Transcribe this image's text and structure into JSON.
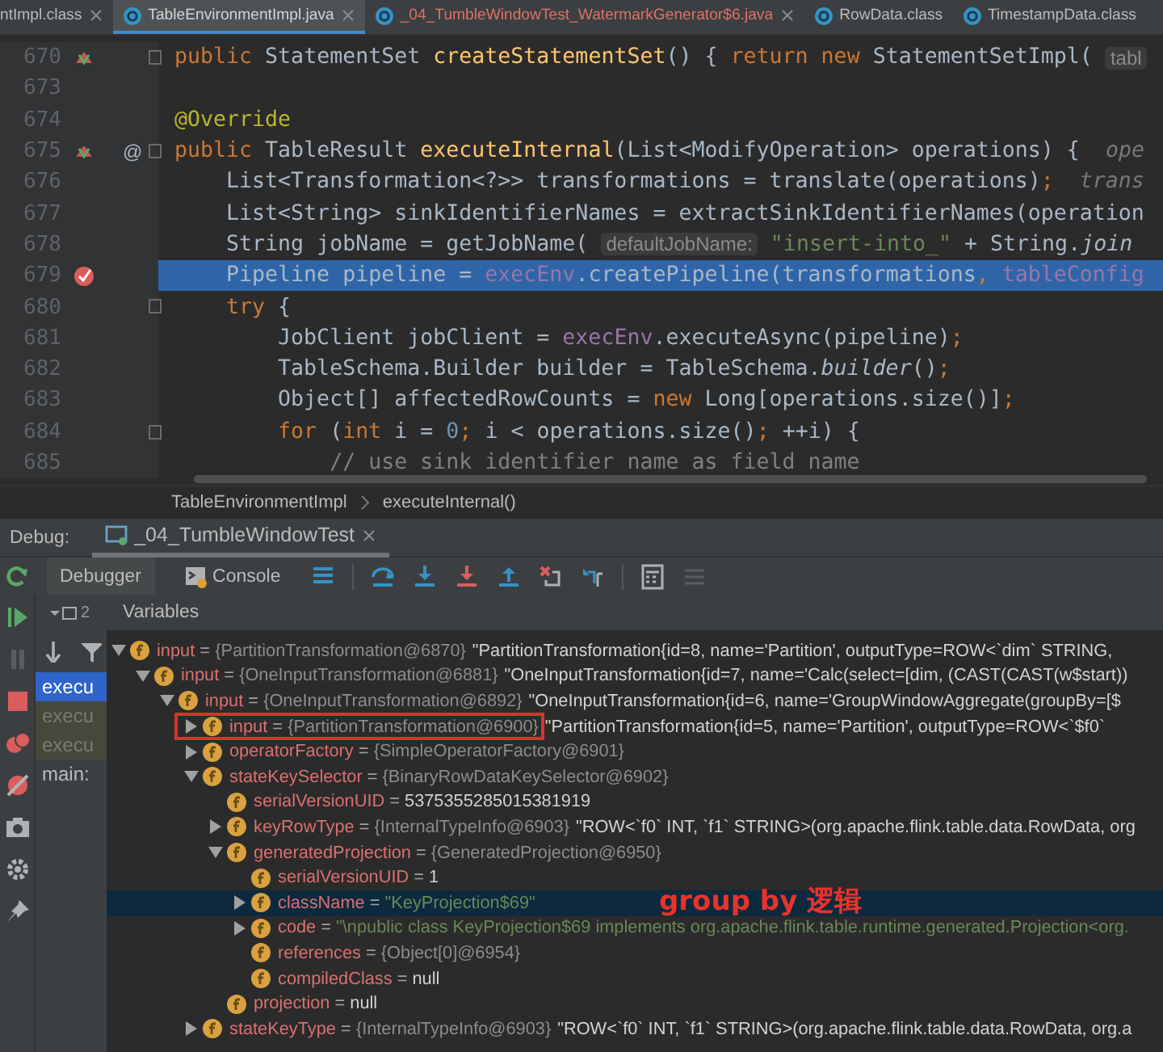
{
  "editor_tabs": [
    {
      "label": "ntImpl.class",
      "selected": false,
      "closable": true,
      "color": "#bbbbbb"
    },
    {
      "label": "TableEnvironmentImpl.java",
      "selected": true,
      "closable": true,
      "color": "#d4d4d4"
    },
    {
      "label": "_04_TumbleWindowTest_WatermarkGenerator$6.java",
      "selected": false,
      "closable": true,
      "color": "#e0706a"
    },
    {
      "label": "RowData.class",
      "selected": false,
      "closable": false,
      "color": "#bbbbbb"
    },
    {
      "label": "TimestampData.class",
      "selected": false,
      "closable": false,
      "color": "#bbbbbb"
    }
  ],
  "editor": {
    "lines": [
      {
        "number": "670",
        "overrides": true,
        "breakpoint": false,
        "fold": true,
        "current": false,
        "tokens": [
          {
            "kind": "keyword",
            "text": "public "
          },
          {
            "kind": "plain",
            "text": "StatementSet "
          },
          {
            "kind": "method",
            "text": "createStatementSet"
          },
          {
            "kind": "plain",
            "text": "() { "
          },
          {
            "kind": "keyword",
            "text": "return new "
          },
          {
            "kind": "plain",
            "text": "StatementSetImpl( "
          },
          {
            "kind": "hint",
            "text": "tabl"
          }
        ]
      },
      {
        "number": "673",
        "overrides": false,
        "breakpoint": false,
        "fold": false,
        "current": false
      },
      {
        "number": "674",
        "overrides": false,
        "breakpoint": false,
        "fold": false,
        "current": false,
        "tokens": [
          {
            "kind": "annotation",
            "text": "@Override"
          }
        ]
      },
      {
        "number": "675",
        "overrides": true,
        "breakpoint": false,
        "marker": "@",
        "fold": true,
        "current": false,
        "tokens": [
          {
            "kind": "keyword",
            "text": "public "
          },
          {
            "kind": "plain",
            "text": "TableResult "
          },
          {
            "kind": "method",
            "text": "executeInternal"
          },
          {
            "kind": "plain",
            "text": "(List<ModifyOperation> operations) {  "
          },
          {
            "kind": "param_hint",
            "text": "ope"
          }
        ]
      },
      {
        "number": "676",
        "overrides": false,
        "breakpoint": false,
        "fold": false,
        "current": false,
        "tokens": [
          {
            "kind": "plain",
            "text": "    List<Transformation<?>> transformations = translate(operations)"
          },
          {
            "kind": "keyword",
            "text": ";  "
          },
          {
            "kind": "param_hint",
            "text": "trans"
          }
        ]
      },
      {
        "number": "677",
        "overrides": false,
        "breakpoint": false,
        "fold": false,
        "current": false,
        "tokens": [
          {
            "kind": "plain",
            "text": "    List<String> sinkIdentifierNames = extractSinkIdentifierNames(operation"
          }
        ]
      },
      {
        "number": "678",
        "overrides": false,
        "breakpoint": false,
        "fold": false,
        "current": false,
        "tokens": [
          {
            "kind": "plain",
            "text": "    String jobName = getJobName( "
          },
          {
            "kind": "hint",
            "text": "defaultJobName:"
          },
          {
            "kind": "string",
            "text": " \"insert-into_\""
          },
          {
            "kind": "plain",
            "text": " + String."
          },
          {
            "kind": "static",
            "text": "join"
          }
        ]
      },
      {
        "number": "679",
        "overrides": false,
        "breakpoint": true,
        "fold": false,
        "current": true,
        "tokens": [
          {
            "kind": "plain",
            "text": "    Pipeline pipeline = "
          },
          {
            "kind": "field",
            "text": "execEnv"
          },
          {
            "kind": "plain",
            "text": ".createPipeline(transformations"
          },
          {
            "kind": "keyword",
            "text": ", "
          },
          {
            "kind": "field",
            "text": "tableConfig"
          }
        ]
      },
      {
        "number": "680",
        "overrides": false,
        "breakpoint": false,
        "fold": true,
        "current": false,
        "tokens": [
          {
            "kind": "keyword",
            "text": "    try "
          },
          {
            "kind": "plain",
            "text": "{"
          }
        ]
      },
      {
        "number": "681",
        "overrides": false,
        "breakpoint": false,
        "fold": false,
        "current": false,
        "tokens": [
          {
            "kind": "plain",
            "text": "        JobClient jobClient = "
          },
          {
            "kind": "field",
            "text": "execEnv"
          },
          {
            "kind": "plain",
            "text": ".executeAsync(pipeline)"
          },
          {
            "kind": "keyword",
            "text": ";"
          }
        ]
      },
      {
        "number": "682",
        "overrides": false,
        "breakpoint": false,
        "fold": false,
        "current": false,
        "tokens": [
          {
            "kind": "plain",
            "text": "        TableSchema.Builder builder = TableSchema."
          },
          {
            "kind": "static",
            "text": "builder"
          },
          {
            "kind": "plain",
            "text": "()"
          },
          {
            "kind": "keyword",
            "text": ";"
          }
        ]
      },
      {
        "number": "683",
        "overrides": false,
        "breakpoint": false,
        "fold": false,
        "current": false,
        "tokens": [
          {
            "kind": "plain",
            "text": "        Object[] affectedRowCounts = "
          },
          {
            "kind": "keyword",
            "text": "new "
          },
          {
            "kind": "plain",
            "text": "Long[operations.size()]"
          },
          {
            "kind": "keyword",
            "text": ";"
          }
        ]
      },
      {
        "number": "684",
        "overrides": false,
        "breakpoint": false,
        "fold": true,
        "current": false,
        "tokens": [
          {
            "kind": "keyword",
            "text": "        for "
          },
          {
            "kind": "plain",
            "text": "("
          },
          {
            "kind": "keyword",
            "text": "int "
          },
          {
            "kind": "plain",
            "text": "i = "
          },
          {
            "kind": "number",
            "text": "0"
          },
          {
            "kind": "keyword",
            "text": "; "
          },
          {
            "kind": "plain",
            "text": "i < operations.size()"
          },
          {
            "kind": "keyword",
            "text": "; "
          },
          {
            "kind": "plain",
            "text": "++i) {"
          }
        ]
      },
      {
        "number": "685",
        "overrides": false,
        "breakpoint": false,
        "fold": false,
        "current": false,
        "tokens": [
          {
            "kind": "comment",
            "text": "            // use sink identifier name as field name"
          }
        ]
      }
    ]
  },
  "breadcrumbs": [
    "TableEnvironmentImpl",
    "executeInternal()"
  ],
  "debug": {
    "label": "Debug:",
    "session_tab": {
      "label": "_04_TumbleWindowTest",
      "selected": true
    },
    "tabs": [
      {
        "label": "Debugger",
        "selected": true
      },
      {
        "label": "Console",
        "selected": false
      }
    ],
    "thread_count": "2",
    "frames": [
      {
        "label": "execu",
        "selected": true,
        "dimmed": false
      },
      {
        "label": "execu",
        "selected": false,
        "dimmed": true
      },
      {
        "label": "execu",
        "selected": false,
        "dimmed": true
      },
      {
        "label": "main:",
        "selected": false,
        "dimmed": false
      }
    ],
    "variables_title": "Variables",
    "variables": [
      {
        "name": "input",
        "sep": "=",
        "ref": "{PartitionTransformation@6870}",
        "value": "\"PartitionTransformation{id=8, name='Partition', outputType=ROW<`dim` STRING,",
        "kind": "plain",
        "expanded": true,
        "selected": false,
        "boxed": false,
        "children": [
          {
            "name": "input",
            "sep": "=",
            "ref": "{OneInputTransformation@6881}",
            "value": "\"OneInputTransformation{id=7, name='Calc(select=[dim, (CAST(CAST(w$start))",
            "kind": "plain",
            "expanded": true,
            "selected": false,
            "boxed": false,
            "children": [
              {
                "name": "input",
                "sep": "=",
                "ref": "{OneInputTransformation@6892}",
                "value": "\"OneInputTransformation{id=6, name='GroupWindowAggregate(groupBy=[$",
                "kind": "plain",
                "expanded": true,
                "selected": false,
                "boxed": false,
                "children": [
                  {
                    "name": "input",
                    "sep": "=",
                    "ref": "{PartitionTransformation@6900}",
                    "value": "\"PartitionTransformation{id=5, name='Partition', outputType=ROW<`$f0`",
                    "kind": "plain",
                    "expanded": false,
                    "selected": false,
                    "boxed": true
                  },
                  {
                    "name": "operatorFactory",
                    "sep": "=",
                    "ref": "{SimpleOperatorFactory@6901}",
                    "expanded": false,
                    "selected": false,
                    "boxed": false
                  },
                  {
                    "name": "stateKeySelector",
                    "sep": "=",
                    "ref": "{BinaryRowDataKeySelector@6902}",
                    "expanded": true,
                    "selected": false,
                    "boxed": false,
                    "children": [
                      {
                        "name": "serialVersionUID",
                        "sep": "=",
                        "value": "5375355285015381919",
                        "kind": "plain",
                        "selected": false,
                        "boxed": false
                      },
                      {
                        "name": "keyRowType",
                        "sep": "=",
                        "ref": "{InternalTypeInfo@6903}",
                        "value": "\"ROW<`f0` INT, `f1` STRING>(org.apache.flink.table.data.RowData, org",
                        "kind": "plain",
                        "expanded": false,
                        "selected": false,
                        "boxed": false
                      },
                      {
                        "name": "generatedProjection",
                        "sep": "=",
                        "ref": "{GeneratedProjection@6950}",
                        "expanded": true,
                        "selected": false,
                        "boxed": false,
                        "children": [
                          {
                            "name": "serialVersionUID",
                            "sep": "=",
                            "value": "1",
                            "kind": "plain",
                            "selected": false,
                            "boxed": false
                          },
                          {
                            "name": "className",
                            "sep": "=",
                            "value": "\"KeyProjection$69\"",
                            "kind": "literal",
                            "expanded": false,
                            "selected": true,
                            "boxed": false
                          },
                          {
                            "name": "code",
                            "sep": "=",
                            "value": "\"\\npublic class KeyProjection$69 implements org.apache.flink.table.runtime.generated.Projection<org.",
                            "kind": "literal",
                            "expanded": false,
                            "selected": false,
                            "boxed": false
                          },
                          {
                            "name": "references",
                            "sep": "=",
                            "ref": "{Object[0]@6954}",
                            "selected": false,
                            "boxed": false
                          },
                          {
                            "name": "compiledClass",
                            "sep": "=",
                            "value": "null",
                            "kind": "plain",
                            "selected": false,
                            "boxed": false
                          }
                        ]
                      },
                      {
                        "name": "projection",
                        "sep": "=",
                        "value": "null",
                        "kind": "plain",
                        "selected": false,
                        "boxed": false
                      }
                    ]
                  },
                  {
                    "name": "stateKeyType",
                    "sep": "=",
                    "ref": "{InternalTypeInfo@6903}",
                    "value": "\"ROW<`f0` INT, `f1` STRING>(org.apache.flink.table.data.RowData, org.a",
                    "kind": "plain",
                    "expanded": false,
                    "selected": false,
                    "boxed": false
                  }
                ]
              }
            ]
          }
        ]
      }
    ]
  },
  "annotation": {
    "text": "group by 逻辑"
  }
}
